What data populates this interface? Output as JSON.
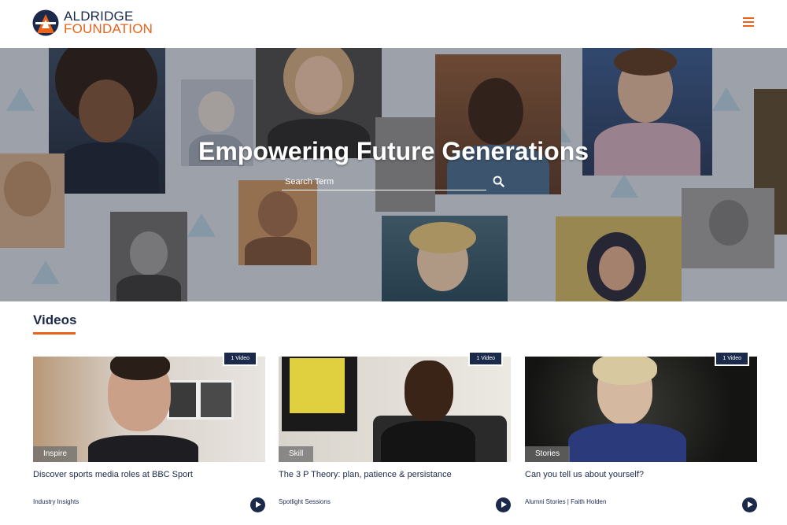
{
  "header": {
    "logo_line1": "ALDRIDGE",
    "logo_line2": "FOUNDATION",
    "menu_icon": "hamburger-menu-icon"
  },
  "hero": {
    "title": "Empowering Future Generations",
    "search": {
      "placeholder": "Search Term",
      "value": ""
    },
    "search_icon": "magnifier-icon"
  },
  "videos": {
    "heading": "Videos",
    "cards": [
      {
        "badge": "1 Video",
        "category": "Inspire",
        "title": "Discover sports media roles at BBC Sport",
        "meta": "Industry Insights"
      },
      {
        "badge": "1 Video",
        "category": "Skill",
        "title": "The 3 P Theory: plan, patience & persistance",
        "meta": "Spotlight Sessions"
      },
      {
        "badge": "1 Video",
        "category": "Stories",
        "title": "Can you tell us about yourself?",
        "meta": "Alumni Stories | Faith Holden"
      }
    ]
  },
  "colors": {
    "navy": "#1b2a4a",
    "orange": "#e8641c",
    "white": "#ffffff"
  }
}
